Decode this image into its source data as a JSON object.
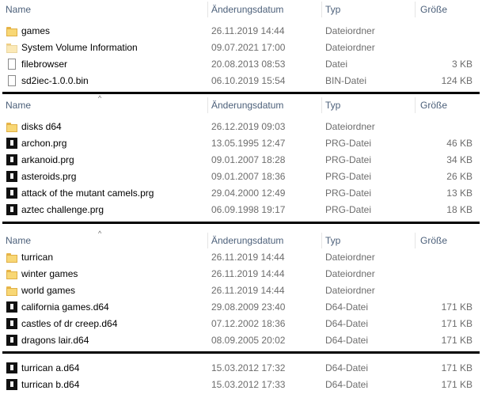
{
  "header": {
    "name_label": "Name",
    "date_label": "Änderungsdatum",
    "type_label": "Typ",
    "size_label": "Größe",
    "sort_glyph": "^"
  },
  "panels": [
    {
      "rows": [
        {
          "icon": "folder-icon",
          "name": "games",
          "date": "26.11.2019 14:44",
          "type": "Dateiordner",
          "size": ""
        },
        {
          "icon": "system-folder-icon",
          "name": "System Volume Information",
          "date": "09.07.2021 17:00",
          "type": "Dateiordner",
          "size": ""
        },
        {
          "icon": "file-icon",
          "name": "filebrowser",
          "date": "20.08.2013 08:53",
          "type": "Datei",
          "size": "3 KB"
        },
        {
          "icon": "file-icon",
          "name": "sd2iec-1.0.0.bin",
          "date": "06.10.2019 15:54",
          "type": "BIN-Datei",
          "size": "124 KB"
        }
      ]
    },
    {
      "rows": [
        {
          "icon": "folder-icon",
          "name": "disks d64",
          "date": "26.12.2019 09:03",
          "type": "Dateiordner",
          "size": ""
        },
        {
          "icon": "c64-file-icon",
          "name": "archon.prg",
          "date": "13.05.1995 12:47",
          "type": "PRG-Datei",
          "size": "46 KB"
        },
        {
          "icon": "c64-file-icon",
          "name": "arkanoid.prg",
          "date": "09.01.2007 18:28",
          "type": "PRG-Datei",
          "size": "34 KB"
        },
        {
          "icon": "c64-file-icon",
          "name": "asteroids.prg",
          "date": "09.01.2007 18:36",
          "type": "PRG-Datei",
          "size": "26 KB"
        },
        {
          "icon": "c64-file-icon",
          "name": "attack of the mutant camels.prg",
          "date": "29.04.2000 12:49",
          "type": "PRG-Datei",
          "size": "13 KB"
        },
        {
          "icon": "c64-file-icon",
          "name": "aztec challenge.prg",
          "date": "06.09.1998 19:17",
          "type": "PRG-Datei",
          "size": "18 KB"
        }
      ]
    },
    {
      "rows": [
        {
          "icon": "folder-icon",
          "name": "turrican",
          "date": "26.11.2019 14:44",
          "type": "Dateiordner",
          "size": ""
        },
        {
          "icon": "folder-icon",
          "name": "winter games",
          "date": "26.11.2019 14:44",
          "type": "Dateiordner",
          "size": ""
        },
        {
          "icon": "folder-icon",
          "name": "world games",
          "date": "26.11.2019 14:44",
          "type": "Dateiordner",
          "size": ""
        },
        {
          "icon": "c64-file-icon",
          "name": "california games.d64",
          "date": "29.08.2009 23:40",
          "type": "D64-Datei",
          "size": "171 KB"
        },
        {
          "icon": "c64-file-icon",
          "name": "castles of dr creep.d64",
          "date": "07.12.2002 18:36",
          "type": "D64-Datei",
          "size": "171 KB"
        },
        {
          "icon": "c64-file-icon",
          "name": "dragons lair.d64",
          "date": "08.09.2005 20:02",
          "type": "D64-Datei",
          "size": "171 KB"
        }
      ]
    },
    {
      "rows": [
        {
          "icon": "c64-file-icon",
          "name": "turrican a.d64",
          "date": "15.03.2012 17:32",
          "type": "D64-Datei",
          "size": "171 KB"
        },
        {
          "icon": "c64-file-icon",
          "name": "turrican b.d64",
          "date": "15.03.2012 17:33",
          "type": "D64-Datei",
          "size": "171 KB"
        }
      ]
    }
  ]
}
